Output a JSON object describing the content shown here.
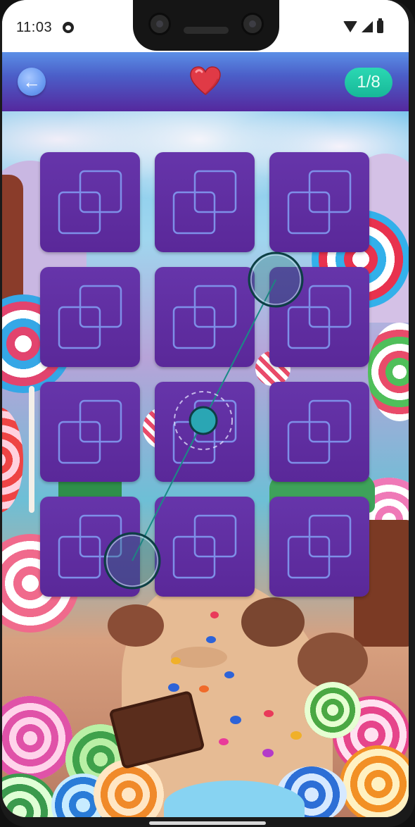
{
  "status_bar": {
    "time": "11:03",
    "icons": [
      "app-notification-icon",
      "wifi-icon",
      "signal-icon",
      "battery-icon"
    ]
  },
  "header": {
    "back_icon": "←",
    "lives_icon": "heart-icon",
    "level_progress": "1/8",
    "colors": {
      "header_top": "#5b8fe6",
      "header_bottom": "#55289e",
      "badge": "#22c7a5",
      "heart": "#e03a46"
    }
  },
  "board": {
    "rows": 4,
    "columns": 3,
    "card_state": "face-down",
    "card_icon": "overlapping-squares-icon",
    "card_color": "#5f2fa2"
  },
  "gesture": {
    "type": "swipe",
    "description_icons": [
      "touch-point-start-icon",
      "touch-point-mid-icon",
      "touch-point-end-icon"
    ]
  }
}
